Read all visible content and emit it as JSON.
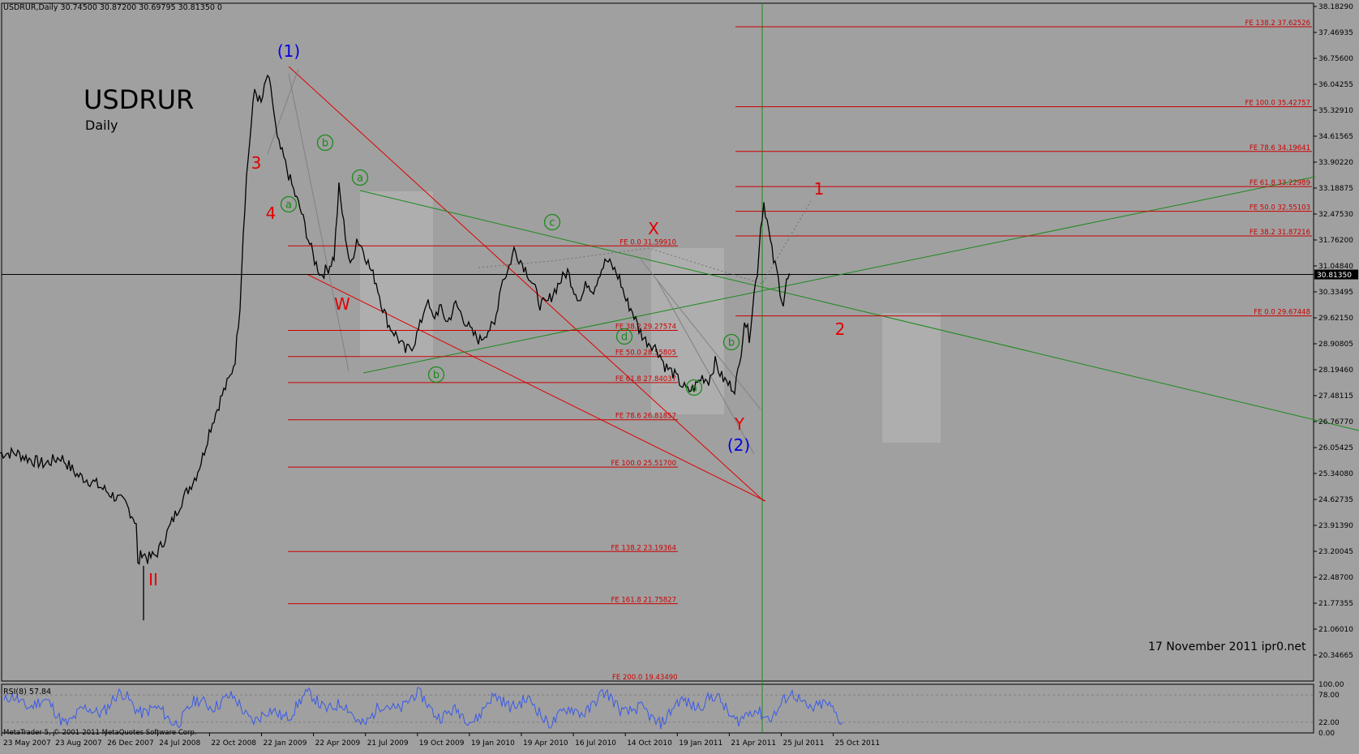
{
  "header": {
    "info": "USDRUR,Daily  30.74500 30.87200 30.69795 30.81350  0",
    "symbol": "USDRUR",
    "timeframe": "Daily",
    "credit": "17 November 2011 ipr0.net",
    "copyright": "MetaTrader 5, © 2001-2011 MetaQuotes Software Corp."
  },
  "colors": {
    "background": "#a0a0a0",
    "price": "#000000",
    "fibo": "#cc0000",
    "trend_red": "#e00000",
    "trend_green": "#1a8a1a",
    "rsi": "#3a5ae8",
    "wave_blue": "#0000e0"
  },
  "chart_data": [
    {
      "type": "line",
      "title": "USDRUR",
      "subtitle": "Daily",
      "ylim": [
        20.0,
        38.3
      ],
      "y_ticks": [
        "38.18290",
        "37.46935",
        "36.75600",
        "36.04255",
        "35.32910",
        "34.61565",
        "33.90220",
        "33.18875",
        "32.47530",
        "31.76200",
        "31.04840",
        "30.33495",
        "29.62150",
        "28.90805",
        "28.19460",
        "27.48115",
        "26.76770",
        "26.05425",
        "25.34080",
        "24.62735",
        "23.91390",
        "23.20045",
        "22.48700",
        "21.77355",
        "21.06010",
        "20.34665"
      ],
      "current_price": "30.81350",
      "x_labels": [
        "23 May 2007",
        "23 Aug 2007",
        "26 Dec 2007",
        "24 Jul 2008",
        "22 Oct 2008",
        "22 Jan 2009",
        "22 Apr 2009",
        "21 Jul 2009",
        "19 Oct 2009",
        "19 Jan 2010",
        "19 Apr 2010",
        "16 Jul 2010",
        "14 Oct 2010",
        "19 Jan 2011",
        "21 Apr 2011",
        "25 Jul 2011",
        "25 Oct 2011"
      ],
      "series": [
        {
          "values": [
            [
              0,
              25.9
            ],
            [
              20,
              25.9
            ],
            [
              40,
              25.7
            ],
            [
              55,
              25.6
            ],
            [
              75,
              25.8
            ],
            [
              95,
              25.3
            ],
            [
              115,
              25.1
            ],
            [
              135,
              24.8
            ],
            [
              155,
              24.5
            ],
            [
              168,
              24.0
            ],
            [
              170,
              22.8
            ],
            [
              175,
              23.2
            ],
            [
              182,
              23.0
            ],
            [
              192,
              23.1
            ],
            [
              200,
              23.4
            ],
            [
              212,
              24.0
            ],
            [
              222,
              24.5
            ],
            [
              232,
              24.9
            ],
            [
              242,
              25.3
            ],
            [
              250,
              25.8
            ],
            [
              258,
              26.5
            ],
            [
              266,
              27.0
            ],
            [
              274,
              27.5
            ],
            [
              284,
              28.0
            ],
            [
              290,
              28.5
            ],
            [
              296,
              30.0
            ],
            [
              300,
              32.0
            ],
            [
              304,
              33.5
            ],
            [
              308,
              34.5
            ],
            [
              314,
              35.9
            ],
            [
              322,
              35.5
            ],
            [
              330,
              36.3
            ],
            [
              336,
              35.6
            ],
            [
              342,
              34.5
            ],
            [
              350,
              34.0
            ],
            [
              358,
              33.4
            ],
            [
              364,
              33.0
            ],
            [
              372,
              32.5
            ],
            [
              380,
              31.8
            ],
            [
              388,
              31.2
            ],
            [
              396,
              30.8
            ],
            [
              405,
              31.0
            ],
            [
              412,
              31.3
            ],
            [
              418,
              33.2
            ],
            [
              424,
              32.2
            ],
            [
              432,
              31.0
            ],
            [
              440,
              31.8
            ],
            [
              448,
              31.5
            ],
            [
              456,
              31.0
            ],
            [
              464,
              30.6
            ],
            [
              472,
              29.9
            ],
            [
              480,
              29.4
            ],
            [
              490,
              29.1
            ],
            [
              500,
              28.7
            ],
            [
              510,
              28.9
            ],
            [
              518,
              29.4
            ],
            [
              526,
              30.1
            ],
            [
              534,
              29.6
            ],
            [
              542,
              29.9
            ],
            [
              552,
              29.5
            ],
            [
              562,
              30.0
            ],
            [
              572,
              29.6
            ],
            [
              582,
              29.2
            ],
            [
              592,
              29.0
            ],
            [
              602,
              29.3
            ],
            [
              610,
              29.4
            ],
            [
              618,
              30.6
            ],
            [
              626,
              30.9
            ],
            [
              634,
              31.5
            ],
            [
              642,
              31.2
            ],
            [
              650,
              30.9
            ],
            [
              658,
              30.5
            ],
            [
              666,
              30.0
            ],
            [
              674,
              30.0
            ],
            [
              682,
              30.3
            ],
            [
              690,
              30.6
            ],
            [
              700,
              30.9
            ],
            [
              708,
              30.4
            ],
            [
              716,
              30.1
            ],
            [
              724,
              30.6
            ],
            [
              732,
              30.4
            ],
            [
              740,
              30.9
            ],
            [
              748,
              31.2
            ],
            [
              756,
              31.0
            ],
            [
              764,
              30.7
            ],
            [
              772,
              30.1
            ],
            [
              780,
              29.8
            ],
            [
              788,
              29.3
            ],
            [
              796,
              29.0
            ],
            [
              804,
              28.9
            ],
            [
              812,
              28.7
            ],
            [
              820,
              28.3
            ],
            [
              830,
              28.1
            ],
            [
              840,
              27.8
            ],
            [
              848,
              27.6
            ],
            [
              856,
              27.7
            ],
            [
              866,
              28.0
            ],
            [
              874,
              27.9
            ],
            [
              882,
              28.4
            ],
            [
              890,
              28.0
            ],
            [
              898,
              27.8
            ],
            [
              906,
              27.7
            ],
            [
              912,
              28.3
            ],
            [
              918,
              29.6
            ],
            [
              924,
              29.1
            ],
            [
              930,
              30.3
            ],
            [
              934,
              30.9
            ],
            [
              938,
              32.1
            ],
            [
              942,
              32.8
            ],
            [
              946,
              32.3
            ],
            [
              950,
              31.7
            ],
            [
              954,
              31.2
            ],
            [
              958,
              30.9
            ],
            [
              962,
              30.4
            ],
            [
              966,
              30.0
            ],
            [
              970,
              30.6
            ],
            [
              975,
              30.8
            ]
          ]
        }
      ],
      "fibo_levels": [
        {
          "label": "FE 138.2 37.62526",
          "value": 37.62526
        },
        {
          "label": "FE 100.0 35.42757",
          "value": 35.42757
        },
        {
          "label": "FE 78.6 34.19641",
          "value": 34.19641
        },
        {
          "label": "FE 61.8 33.22989",
          "value": 33.22989
        },
        {
          "label": "FE 50.0 32.55103",
          "value": 32.55103
        },
        {
          "label": "FE 38.2 31.87216",
          "value": 31.87216
        },
        {
          "label": "FE 0.0 29.67448",
          "value": 29.67448
        },
        {
          "label": "FE 0.0 31.59910",
          "value": 31.5991
        },
        {
          "label": "FE 38.2 29.27574",
          "value": 29.27574
        },
        {
          "label": "FE 50.0 28.55805",
          "value": 28.55805
        },
        {
          "label": "FE 61.8 27.84037",
          "value": 27.84037
        },
        {
          "label": "FE 78.6 26.81857",
          "value": 26.81857
        },
        {
          "label": "FE 100.0 25.51700",
          "value": 25.517
        },
        {
          "label": "FE 138.2 23.19364",
          "value": 23.19364
        },
        {
          "label": "FE 161.8 21.75827",
          "value": 21.75827
        },
        {
          "label": "FE 200.0 19.43490",
          "value": 19.4349
        }
      ],
      "wave_labels": [
        {
          "text": "(1)",
          "color": "blue"
        },
        {
          "text": "(2)",
          "color": "blue"
        },
        {
          "text": "3",
          "color": "red"
        },
        {
          "text": "4",
          "color": "red"
        },
        {
          "text": "II",
          "color": "red"
        },
        {
          "text": "W",
          "color": "red"
        },
        {
          "text": "X",
          "color": "red"
        },
        {
          "text": "Y",
          "color": "red"
        },
        {
          "text": "1",
          "color": "red"
        },
        {
          "text": "2",
          "color": "red"
        },
        {
          "text": "a",
          "color": "green"
        },
        {
          "text": "b",
          "color": "green"
        },
        {
          "text": "a",
          "color": "green"
        },
        {
          "text": "b",
          "color": "green"
        },
        {
          "text": "c",
          "color": "green"
        },
        {
          "text": "d",
          "color": "green"
        },
        {
          "text": "a",
          "color": "green"
        },
        {
          "text": "b",
          "color": "green"
        }
      ]
    },
    {
      "type": "line",
      "title": "RSI(8) 57.84",
      "ylim": [
        0,
        100
      ],
      "y_ticks": [
        "100.00",
        "78.00",
        "22.00",
        "0.00"
      ],
      "levels": [
        78,
        22
      ],
      "last_value": 57.84
    }
  ]
}
